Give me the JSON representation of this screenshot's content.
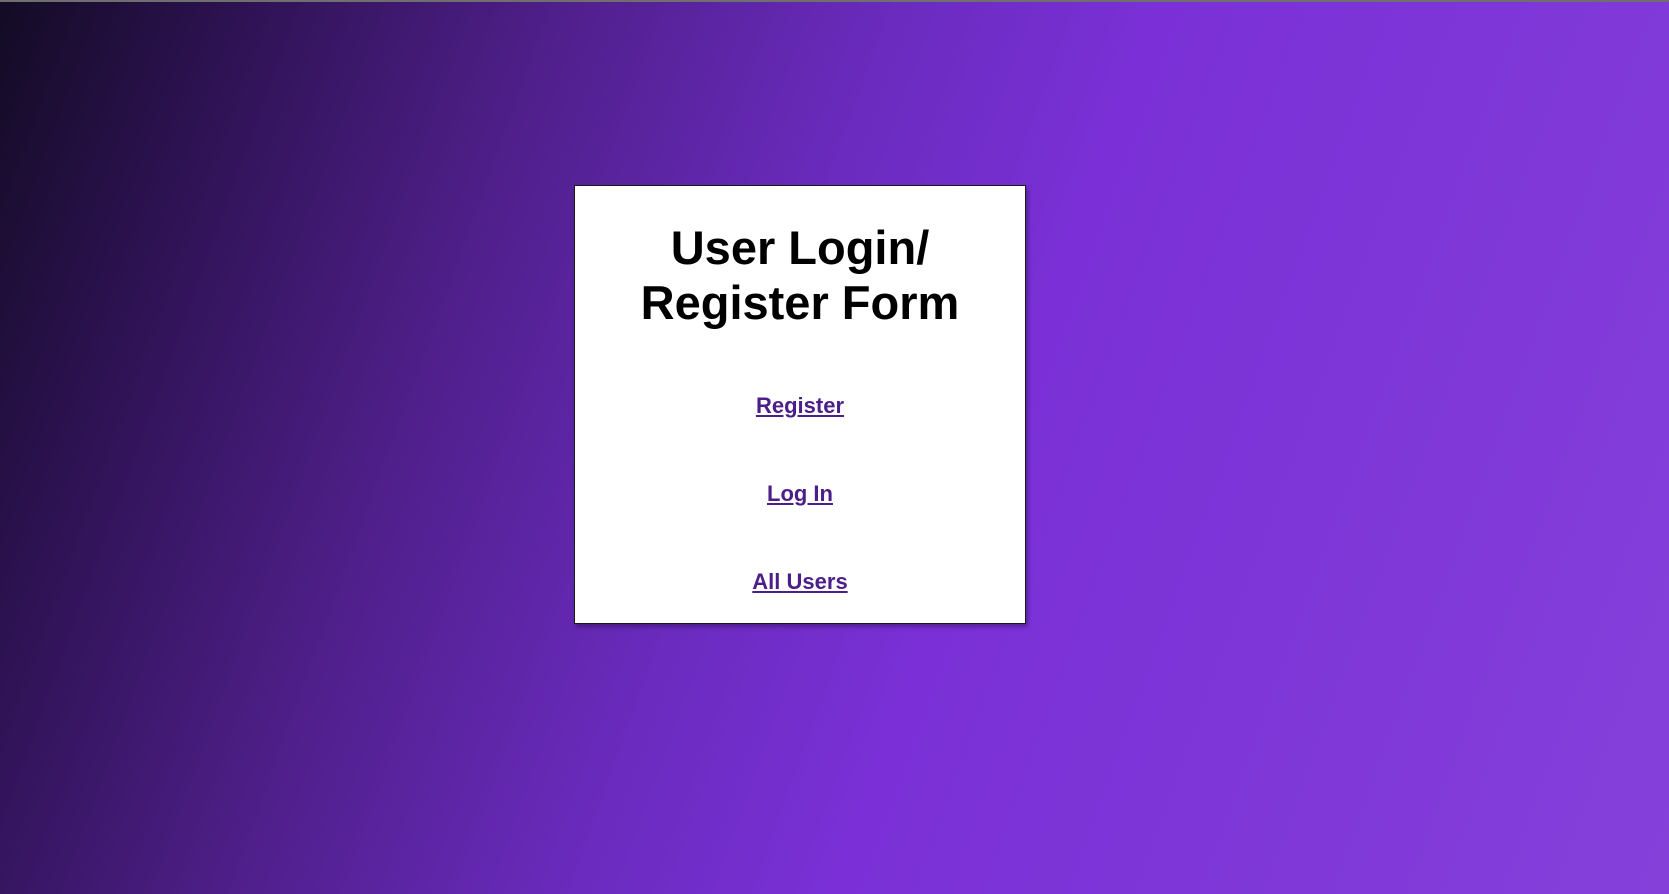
{
  "card": {
    "title_line1": "User Login/",
    "title_line2": "Register Form"
  },
  "links": {
    "register": "Register",
    "login": "Log In",
    "all_users": "All Users"
  },
  "colors": {
    "link": "#4b1e8a",
    "background_dark": "#130b24",
    "background_light": "#8540da",
    "card": "#ffffff"
  }
}
